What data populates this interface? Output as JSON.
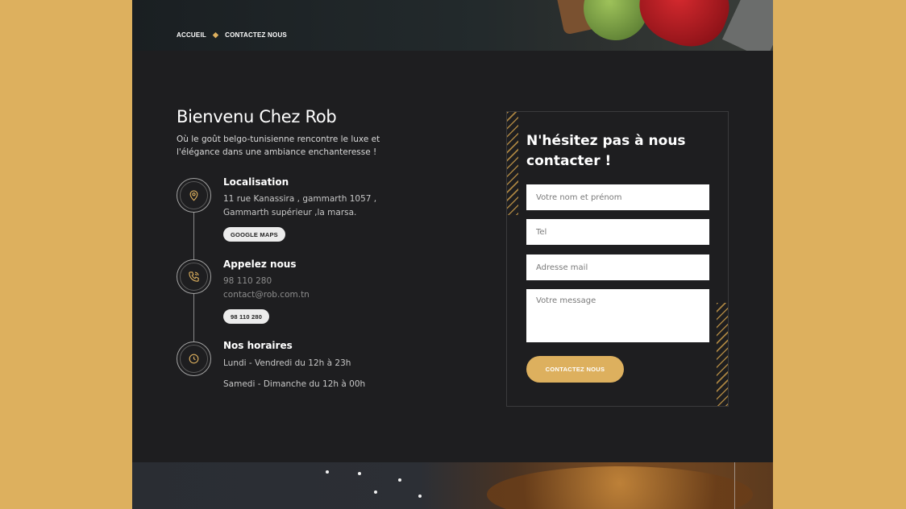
{
  "breadcrumb": {
    "home": "ACCUEIL",
    "separator": "◆",
    "current": "CONTACTEZ NOUS"
  },
  "welcome": {
    "title": "Bienvenu Chez Rob",
    "subtitle": "Où le goût belgo-tunisienne rencontre le luxe et l'élégance dans une ambiance enchanteresse !"
  },
  "location": {
    "icon": "map-pin-icon",
    "title": "Localisation",
    "line1": "11 rue Kanassira , gammarth 1057 ,",
    "line2": "Gammarth supérieur ,la marsa.",
    "button": "GOOGLE MAPS"
  },
  "call": {
    "icon": "phone-icon",
    "title": "Appelez nous",
    "phone": "98 110 280",
    "email": "contact@rob.com.tn",
    "button": "98 110 280"
  },
  "hours": {
    "icon": "clock-icon",
    "title": "Nos horaires",
    "weekdays": "Lundi - Vendredi du 12h à 23h",
    "weekend": "Samedi - Dimanche du 12h à 00h"
  },
  "form": {
    "title": "N'hésitez pas à nous contacter !",
    "name_placeholder": "Votre nom et prénom",
    "tel_placeholder": "Tel",
    "email_placeholder": "Adresse mail",
    "message_placeholder": "Votre message",
    "submit": "CONTACTEZ NOUS"
  },
  "colors": {
    "accent": "#ddb05e",
    "background": "#1e1e20",
    "outer": "#ddb05e"
  }
}
